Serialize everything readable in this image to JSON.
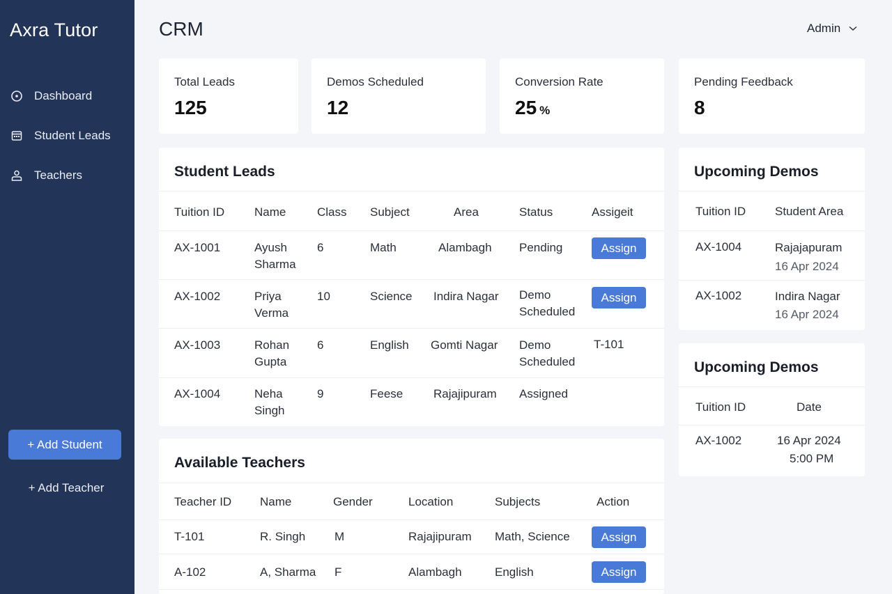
{
  "sidebar": {
    "brand": "Axra Tutor",
    "items": [
      {
        "label": "Dashboard"
      },
      {
        "label": "Student Leads"
      },
      {
        "label": "Teachers"
      }
    ],
    "add_student": "+ Add Student",
    "add_teacher": "+ Add Teacher"
  },
  "header": {
    "title": "CRM",
    "user": "Admin"
  },
  "stats": [
    {
      "label": "Total Leads",
      "value": "125",
      "unit": ""
    },
    {
      "label": "Demos Scheduled",
      "value": "12",
      "unit": ""
    },
    {
      "label": "Conversion Rate",
      "value": "25",
      "unit": "%"
    },
    {
      "label": "Pending Feedback",
      "value": "8",
      "unit": ""
    }
  ],
  "student_leads": {
    "title": "Student Leads",
    "columns": [
      "Tuition ID",
      "Name",
      "Class",
      "Subject",
      "Area",
      "Status",
      "Assigeit"
    ],
    "rows": [
      {
        "id": "AX-1001",
        "name": "Ayush Sharma",
        "class": "6",
        "subject": "Math",
        "area": "Alambagh",
        "status": "Pending",
        "assign": "Assign"
      },
      {
        "id": "AX-1002",
        "name": "Priya Verma",
        "class": "10",
        "subject": "Science",
        "area": "Indira Nagar",
        "status": "Demo Scheduled",
        "assign": "Assign"
      },
      {
        "id": "AX-1003",
        "name": "Rohan Gupta",
        "class": "6",
        "subject": "English",
        "area": "Gomti Nagar",
        "status": "Demo Scheduled",
        "assign": "T-101"
      },
      {
        "id": "AX-1004",
        "name": "Neha Singh",
        "class": "9",
        "subject": "Feese",
        "area": "Rajajipuram",
        "status": "Assigned",
        "assign": ""
      }
    ]
  },
  "teachers": {
    "title": "Available Teachers",
    "columns": [
      "Teacher ID",
      "Name",
      "Gender",
      "Location",
      "Subjects",
      "Action"
    ],
    "rows": [
      {
        "id": "T-101",
        "name": "R. Singh",
        "gender": "M",
        "location": "Rajajipuram",
        "subjects": "Math, Science",
        "action": "Assign"
      },
      {
        "id": "A-102",
        "name": "A, Sharma",
        "gender": "F",
        "location": "Alambagh",
        "subjects": "English",
        "action": "Assign"
      }
    ]
  },
  "demos1": {
    "title": "Upcoming Demos",
    "columns": [
      "Tuition ID",
      "Student Area"
    ],
    "rows": [
      {
        "id": "AX-1004",
        "area": "Rajajapuram",
        "date": "16 Apr 2024"
      },
      {
        "id": "AX-1002",
        "area": "Indira Nagar",
        "date": "16 Apr 2024"
      }
    ]
  },
  "demos2": {
    "title": "Upcoming Demos",
    "columns": [
      "Tuition ID",
      "Date"
    ],
    "rows": [
      {
        "id": "AX-1002",
        "date": "16 Apr 2024",
        "time": "5:00 PM"
      }
    ]
  },
  "colors": {
    "sidebar": "#223457",
    "accent": "#4a7ad8",
    "background": "#f4f5f9"
  }
}
